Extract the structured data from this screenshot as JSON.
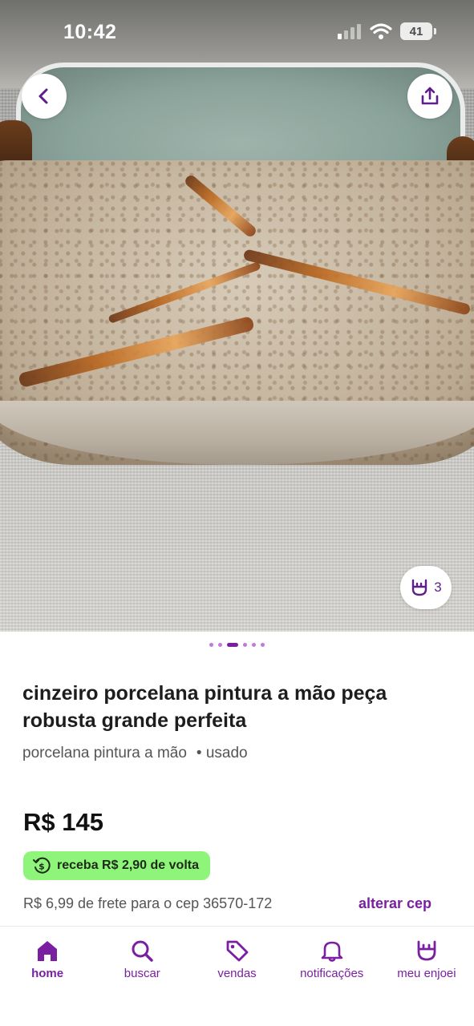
{
  "status_bar": {
    "time": "10:42",
    "battery": "41"
  },
  "gallery": {
    "image_count": 6,
    "active_index": 2,
    "likes_count": "3"
  },
  "product": {
    "title": "cinzeiro porcelana pintura a mão peça robusta grande perfeita",
    "brand": "porcelana pintura a mão",
    "condition": "• usado",
    "price": "R$ 145",
    "cashback": "receba R$ 2,90 de volta",
    "shipping": "R$ 6,99 de frete para o cep 36570-172",
    "change_cep": "alterar cep"
  },
  "nav": {
    "items": [
      {
        "label": "home",
        "icon": "home-icon",
        "active": true
      },
      {
        "label": "buscar",
        "icon": "search-icon",
        "active": false
      },
      {
        "label": "vendas",
        "icon": "tag-icon",
        "active": false
      },
      {
        "label": "notificações",
        "icon": "bell-icon",
        "active": false
      },
      {
        "label": "meu enjoei",
        "icon": "rock-hand-icon",
        "active": false
      }
    ]
  },
  "colors": {
    "accent": "#7a1fa2",
    "cashback_bg": "#8ff57a"
  }
}
